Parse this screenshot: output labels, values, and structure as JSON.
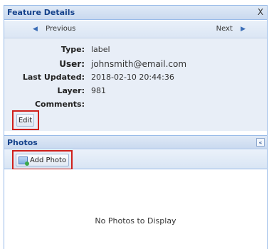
{
  "feature_panel": {
    "title": "Feature Details",
    "close_glyph": "X",
    "nav": {
      "previous_label": "Previous",
      "next_label": "Next",
      "previous_icon": "arrow-left-icon",
      "next_icon": "arrow-right-icon"
    },
    "fields": [
      {
        "label": "Type:",
        "value": "label"
      },
      {
        "label": "User:",
        "value": "johnsmith@email.com"
      },
      {
        "label": "Last Updated:",
        "value": "2018-02-10 20:44:36"
      },
      {
        "label": "Layer:",
        "value": "981"
      },
      {
        "label": "Comments:",
        "value": ""
      }
    ],
    "edit_label": "Edit"
  },
  "photos_panel": {
    "title": "Photos",
    "collapse_glyph": "«",
    "add_photo_label": "Add Photo",
    "add_photo_icon": "photo-add-icon",
    "empty_text": "No Photos to Display"
  },
  "colors": {
    "header_text": "#15428b",
    "highlight_border": "#d0201b",
    "panel_border": "#99bbe8"
  }
}
